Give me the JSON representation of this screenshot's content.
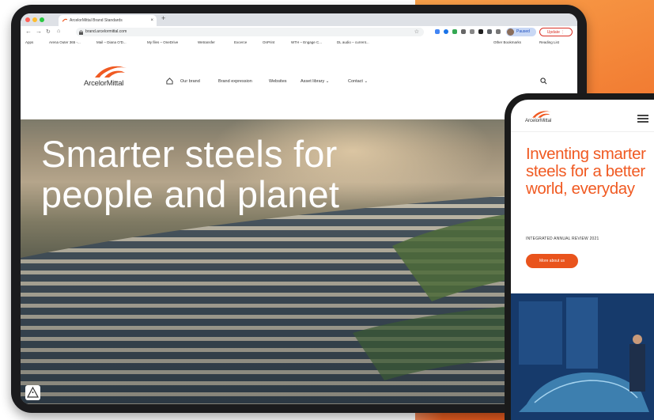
{
  "colors": {
    "accent": "#f05a22",
    "button": "#e9541d",
    "background_orange": "#f0722c"
  },
  "browser": {
    "tab_title": "ArcelorMittal Brand Standards",
    "url": "brand.arcelormittal.com",
    "paused_label": "Paused",
    "update_label": "Update",
    "bookmarks": [
      "Apps",
      "Arena Outer 365 -...",
      "Mail – Diana O'D...",
      "My files – OneDrive",
      "Wetransfer",
      "Excerce",
      "OnPrint",
      "WTH – Engage C...",
      "DL audio – current...",
      "Other Bookmarks",
      "Reading List"
    ]
  },
  "site": {
    "logo_text": "ArcelorMittal",
    "nav": [
      "Our brand",
      "Brand expression",
      "Websites",
      "Asset library",
      "Contact"
    ],
    "hero_title": "Smarter steels for people and planet"
  },
  "phone": {
    "logo_text": "ArcelorMittal",
    "headline": "Inventing smarter steels for a better world, everyday",
    "subtitle": "INTEGRATED ANNUAL REVIEW 2021",
    "button_label": "More about us"
  }
}
